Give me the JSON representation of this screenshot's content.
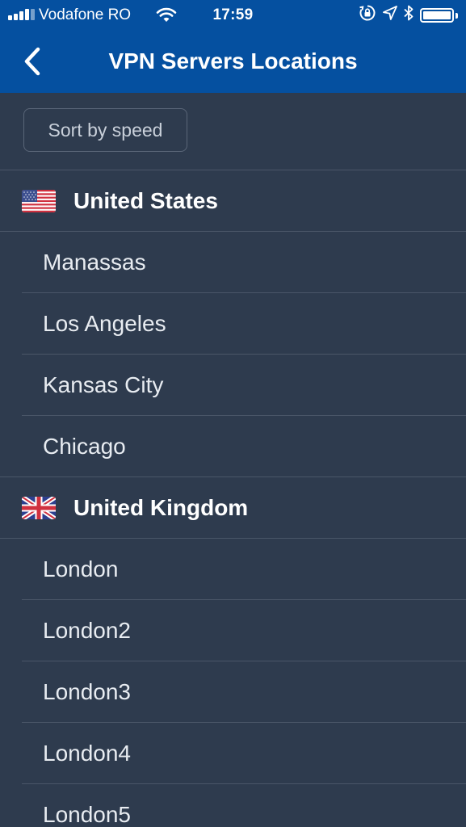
{
  "status_bar": {
    "carrier": "Vodafone RO",
    "time": "17:59",
    "signal_bars": 4,
    "battery_level": 1.0
  },
  "nav": {
    "title": "VPN Servers Locations"
  },
  "sort": {
    "label": "Sort by speed"
  },
  "countries": [
    {
      "name": "United States",
      "flag": "us-flag-icon",
      "cities": [
        "Manassas",
        "Los Angeles",
        "Kansas City",
        "Chicago"
      ]
    },
    {
      "name": "United Kingdom",
      "flag": "uk-flag-icon",
      "cities": [
        "London",
        "London2",
        "London3",
        "London4",
        "London5"
      ]
    }
  ],
  "colors": {
    "header_blue": "#0550a0",
    "background": "#2e3b4e",
    "divider": "#4a5668"
  }
}
